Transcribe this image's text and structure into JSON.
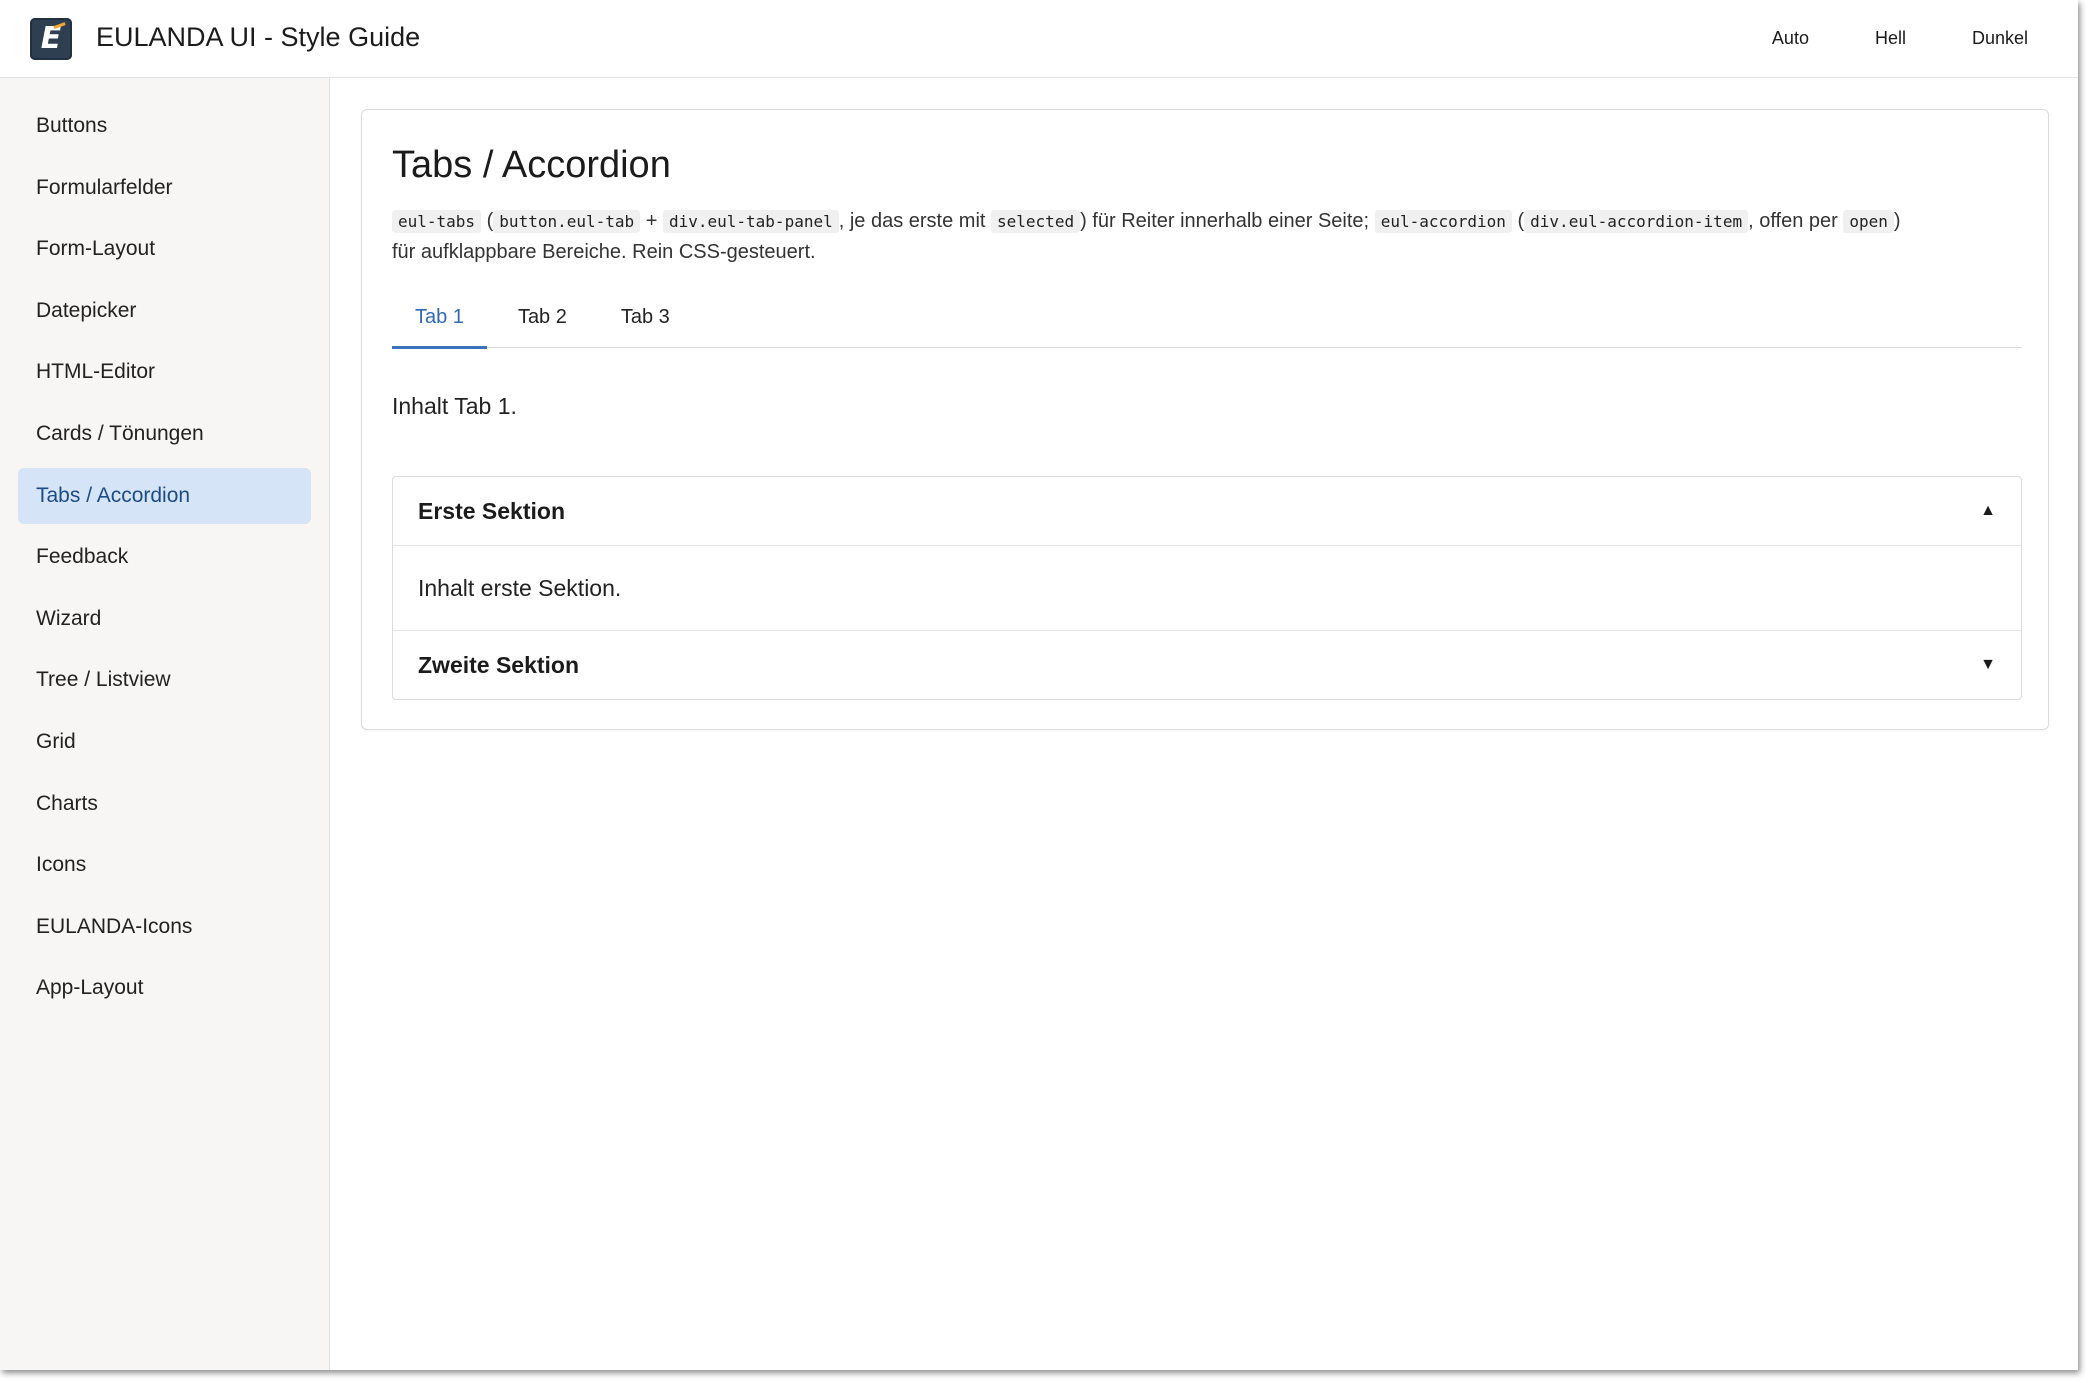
{
  "header": {
    "title": "EULANDA UI - Style Guide",
    "logo_letter": "E",
    "theme_options": [
      "Auto",
      "Hell",
      "Dunkel"
    ]
  },
  "sidebar": {
    "items": [
      {
        "label": "Buttons",
        "active": false
      },
      {
        "label": "Formularfelder",
        "active": false
      },
      {
        "label": "Form-Layout",
        "active": false
      },
      {
        "label": "Datepicker",
        "active": false
      },
      {
        "label": "HTML-Editor",
        "active": false
      },
      {
        "label": "Cards / Tönungen",
        "active": false
      },
      {
        "label": "Tabs / Accordion",
        "active": true
      },
      {
        "label": "Feedback",
        "active": false
      },
      {
        "label": "Wizard",
        "active": false
      },
      {
        "label": "Tree / Listview",
        "active": false
      },
      {
        "label": "Grid",
        "active": false
      },
      {
        "label": "Charts",
        "active": false
      },
      {
        "label": "Icons",
        "active": false
      },
      {
        "label": "EULANDA-Icons",
        "active": false
      },
      {
        "label": "App-Layout",
        "active": false
      }
    ]
  },
  "main": {
    "title": "Tabs / Accordion",
    "description": {
      "code1": "eul-tabs",
      "t1": "(",
      "code2": "button.eul-tab",
      "t2": "+",
      "code3": "div.eul-tab-panel",
      "t3": ", je das erste mit",
      "code4": "selected",
      "t4": ") für Reiter innerhalb einer Seite;",
      "code5": "eul-accordion",
      "t5": "(",
      "code6": "div.eul-accordion-item",
      "t6": ", offen per",
      "code7": "open",
      "t7": ")",
      "t8": "für aufklappbare Bereiche. Rein CSS-gesteuert."
    },
    "tabs": [
      {
        "label": "Tab 1",
        "selected": true
      },
      {
        "label": "Tab 2",
        "selected": false
      },
      {
        "label": "Tab 3",
        "selected": false
      }
    ],
    "tab_panel_text": "Inhalt Tab 1.",
    "accordion": {
      "items": [
        {
          "title": "Erste Sektion",
          "open": true,
          "content": "Inhalt erste Sektion.",
          "arrow": "▲"
        },
        {
          "title": "Zweite Sektion",
          "open": false,
          "arrow": "▼"
        }
      ]
    }
  },
  "colors": {
    "accent": "#2f6ab3",
    "active_nav_bg": "#d5e4f6",
    "sidebar_bg": "#f7f6f5"
  }
}
